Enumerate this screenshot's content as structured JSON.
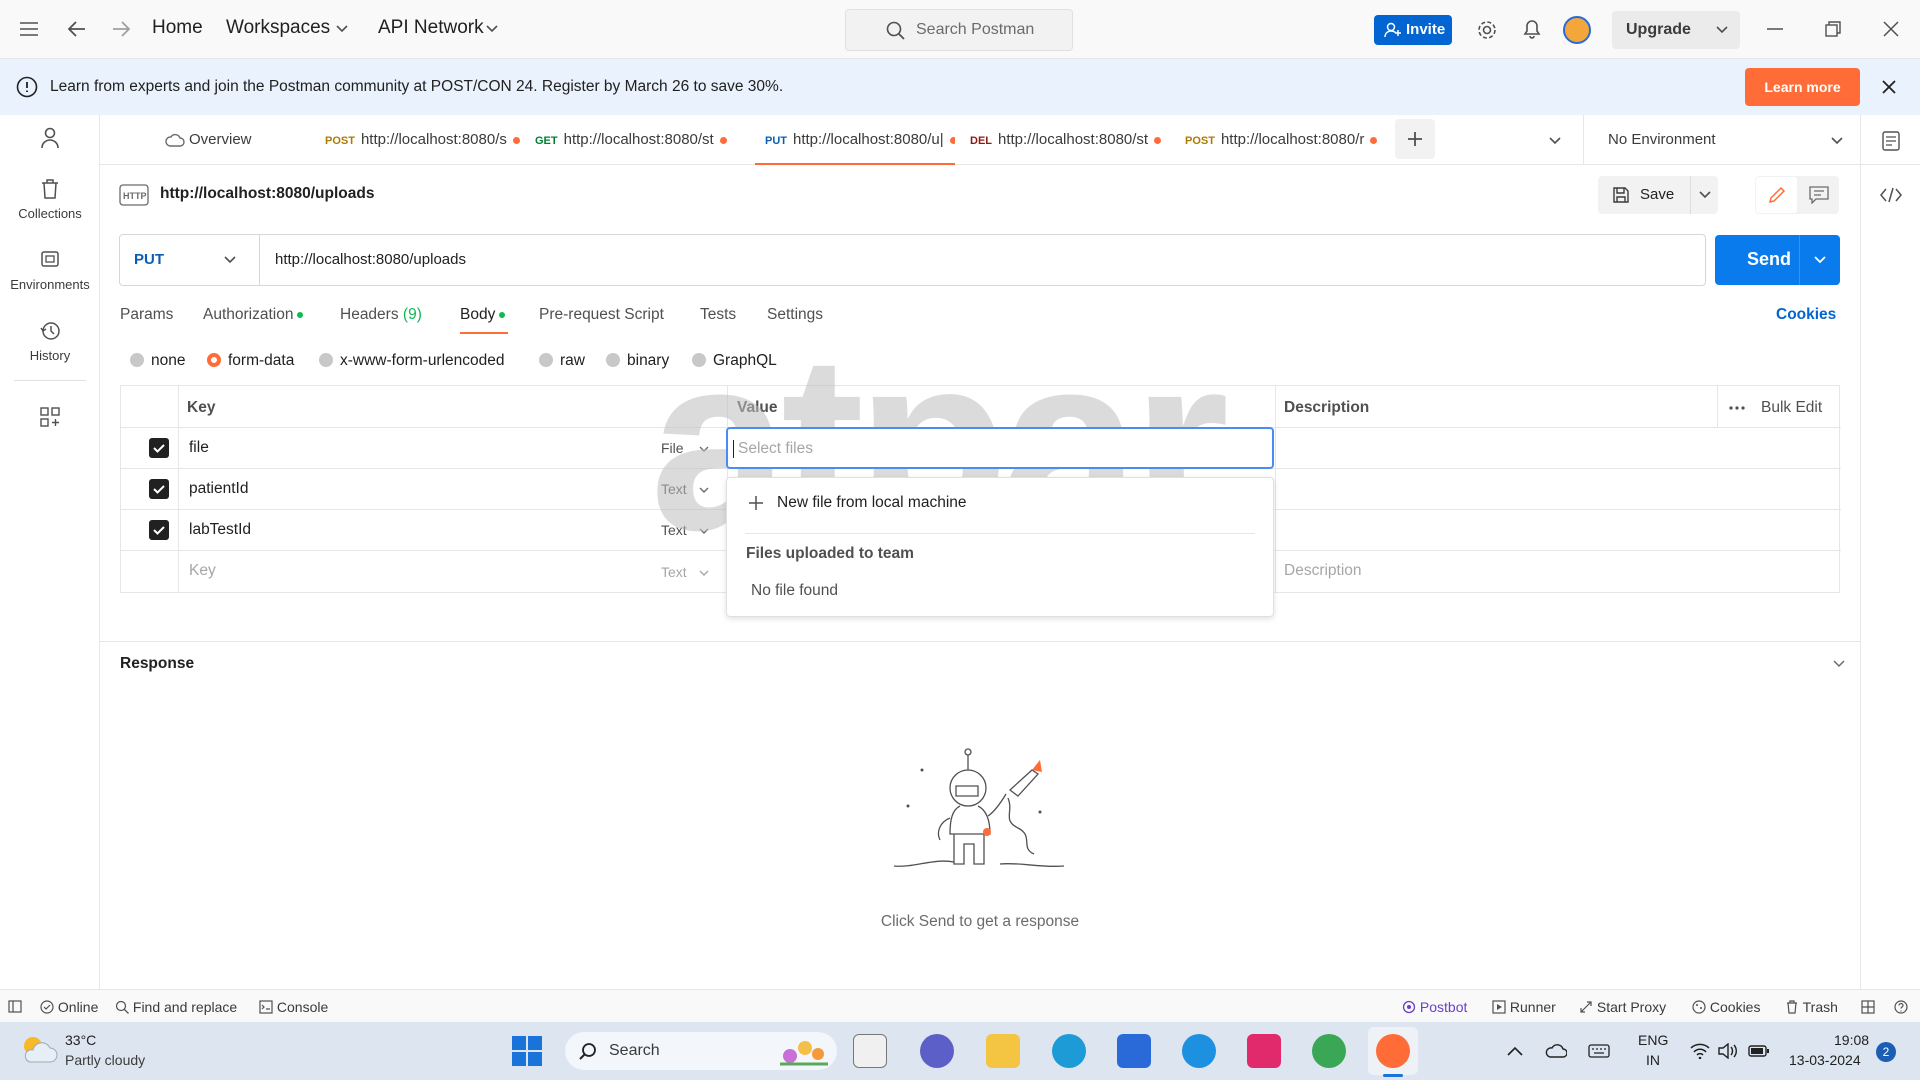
{
  "topbar": {
    "home": "Home",
    "workspaces": "Workspaces",
    "api_network": "API Network",
    "search_placeholder": "Search Postman",
    "invite": "Invite",
    "upgrade": "Upgrade"
  },
  "banner": {
    "message": "Learn from experts and join the Postman community at POST/CON 24. Register by March 26 to save 30%.",
    "learn_more": "Learn more"
  },
  "sidebar": {
    "items": [
      {
        "label": "Collections",
        "icon": "trash-can-icon"
      },
      {
        "label": "Environments",
        "icon": "environment-icon"
      },
      {
        "label": "History",
        "icon": "history-icon"
      }
    ]
  },
  "tabs": [
    {
      "label": "Overview",
      "method": ""
    },
    {
      "method": "POST",
      "label": "http://localhost:8080/s"
    },
    {
      "method": "GET",
      "label": "http://localhost:8080/st"
    },
    {
      "method": "PUT",
      "label": "http://localhost:8080/u|"
    },
    {
      "method": "DEL",
      "label": "http://localhost:8080/st"
    },
    {
      "method": "POST",
      "label": "http://localhost:8080/r"
    }
  ],
  "environment": "No Environment",
  "request": {
    "title": "http://localhost:8080/uploads",
    "save": "Save",
    "method": "PUT",
    "url": "http://localhost:8080/uploads",
    "send": "Send"
  },
  "subtabs": [
    "Params",
    "Authorization",
    "Headers",
    "(9)",
    "Body",
    "Pre-request Script",
    "Tests",
    "Settings"
  ],
  "cookies": "Cookies",
  "body_types": [
    "none",
    "form-data",
    "x-www-form-urlencoded",
    "raw",
    "binary",
    "GraphQL"
  ],
  "table": {
    "headers": {
      "key": "Key",
      "value": "Value",
      "description": "Description",
      "bulk_edit": "Bulk Edit"
    },
    "rows": [
      {
        "key": "file",
        "type": "File"
      },
      {
        "key": "patientId",
        "type": "Text"
      },
      {
        "key": "labTestId",
        "type": "Text"
      }
    ],
    "new_row": {
      "key": "Key",
      "type": "Text",
      "description": "Description"
    }
  },
  "value_input": {
    "placeholder": "Select files"
  },
  "dropdown": {
    "new_file": "New file from local machine",
    "section": "Files uploaded to team",
    "empty": "No file found"
  },
  "watermark": "atpar",
  "response": {
    "title": "Response",
    "empty": "Click Send to get a response"
  },
  "statusbar": {
    "online": "Online",
    "find": "Find and replace",
    "console": "Console",
    "postbot": "Postbot",
    "runner": "Runner",
    "proxy": "Start Proxy",
    "cookies": "Cookies",
    "trash": "Trash"
  },
  "taskbar": {
    "temp": "33°C",
    "weather": "Partly cloudy",
    "search": "Search",
    "lang1": "ENG",
    "lang2": "IN",
    "time": "19:08",
    "date": "13-03-2024",
    "notifications": "2"
  },
  "colors": {
    "accent": "#ff6c37",
    "send": "#097bed",
    "invite": "#0265d2",
    "link": "#0265d2"
  }
}
